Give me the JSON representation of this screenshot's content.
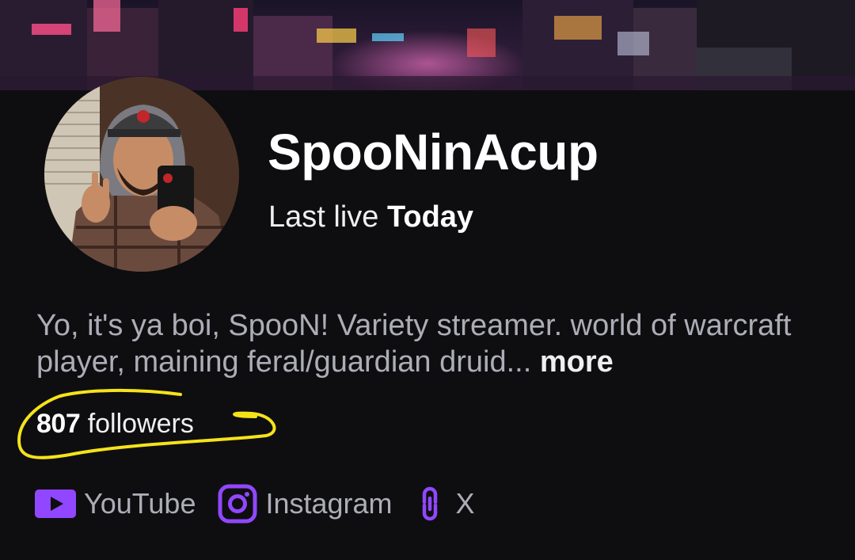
{
  "channel": {
    "name": "SpooNinAcup",
    "last_live_label": "Last live",
    "last_live_value": "Today",
    "bio": "Yo, it's ya boi, SpooN! Variety streamer. world of warcraft player, maining feral/guardian druid...",
    "bio_more": "more",
    "followers_count": "807",
    "followers_label": "followers"
  },
  "socials": [
    {
      "label": "YouTube",
      "icon": "youtube-icon"
    },
    {
      "label": "Instagram",
      "icon": "instagram-icon"
    },
    {
      "label": "X",
      "icon": "link-icon"
    }
  ],
  "colors": {
    "accent": "#9147ff",
    "highlight": "#f5e31a",
    "background": "#0e0e10"
  }
}
